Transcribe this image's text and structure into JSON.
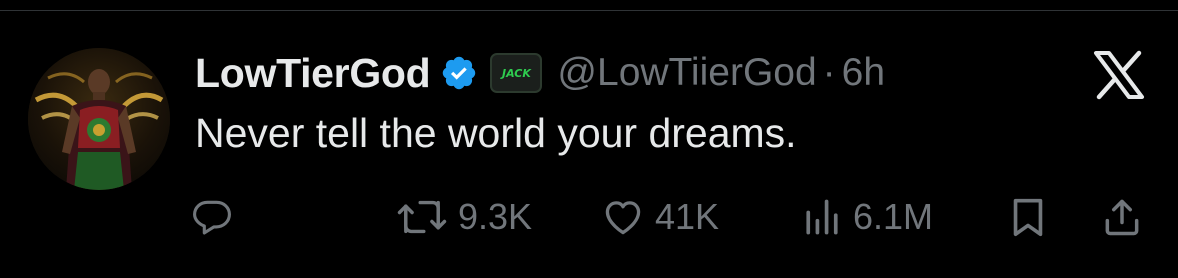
{
  "tweet": {
    "display_name": "LowTierGod",
    "affiliate_badge_text": "JACK",
    "handle": "@LowTiierGod",
    "separator": "·",
    "timestamp": "6h",
    "text": "Never tell the world your dreams."
  },
  "actions": {
    "reposts": "9.3K",
    "likes": "41K",
    "views": "6.1M"
  },
  "icons": {
    "verified": "verified-badge-icon",
    "affiliate": "affiliate-badge-icon",
    "platform": "x-logo-icon",
    "reply": "reply-icon",
    "repost": "repost-icon",
    "like": "heart-icon",
    "views": "views-icon",
    "bookmark": "bookmark-icon",
    "share": "share-icon"
  },
  "colors": {
    "background": "#000000",
    "text_primary": "#e7e9ea",
    "text_secondary": "#71767b",
    "verified_blue": "#1d9bf0",
    "affiliate_green": "#2ecc4f"
  }
}
